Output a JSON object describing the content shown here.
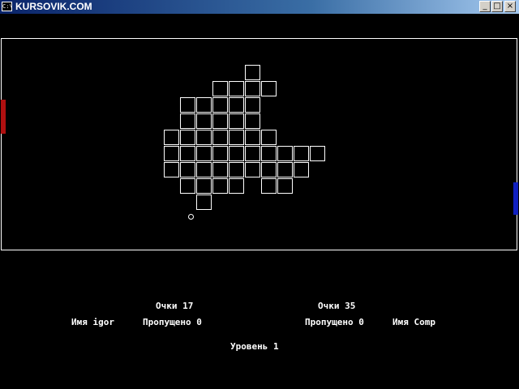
{
  "window": {
    "title": "KURSOVIK.COM",
    "icon": "console-icon",
    "icon_text": "C:\\",
    "buttons": {
      "minimize": "_",
      "maximize": "□",
      "close": "×"
    }
  },
  "colors": {
    "background": "#000000",
    "border": "#ffffff",
    "left_paddle": "#b01010",
    "right_paddle": "#1020c0",
    "text": "#ffffff"
  },
  "bricks": [
    [
      0,
      0,
      0,
      0,
      0,
      1,
      0,
      0,
      0,
      0
    ],
    [
      0,
      0,
      0,
      1,
      1,
      1,
      1,
      0,
      0,
      0
    ],
    [
      0,
      1,
      1,
      1,
      1,
      1,
      0,
      0,
      0,
      0
    ],
    [
      0,
      1,
      1,
      1,
      1,
      1,
      0,
      0,
      0,
      0
    ],
    [
      1,
      1,
      1,
      1,
      1,
      1,
      1,
      0,
      0,
      0
    ],
    [
      1,
      1,
      1,
      1,
      1,
      1,
      1,
      1,
      1,
      1
    ],
    [
      1,
      1,
      1,
      1,
      1,
      1,
      1,
      1,
      1,
      0
    ],
    [
      0,
      1,
      1,
      1,
      1,
      0,
      1,
      1,
      0,
      0
    ],
    [
      0,
      0,
      1,
      0,
      0,
      0,
      0,
      0,
      0,
      0
    ]
  ],
  "left_player": {
    "score_label": "Очки",
    "score": "17",
    "name_label": "Имя",
    "name": "igor",
    "missed_label": "Пропущено",
    "missed": "0"
  },
  "right_player": {
    "score_label": "Очки",
    "score": "35",
    "name_label": "Имя",
    "name": "Comp",
    "missed_label": "Пропущено",
    "missed": "0"
  },
  "level": {
    "label": "Уровень",
    "value": "1"
  }
}
